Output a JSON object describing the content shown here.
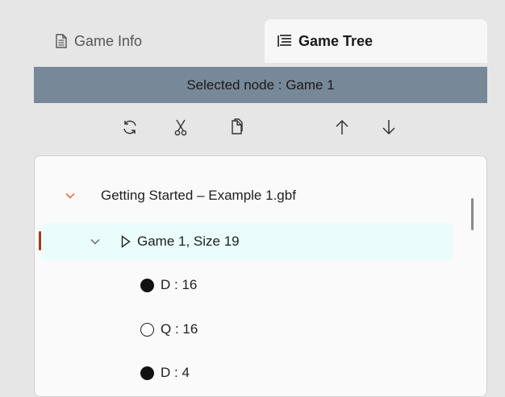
{
  "tabs": [
    {
      "label": "Game Info",
      "icon": "document-icon",
      "active": false
    },
    {
      "label": "Game Tree",
      "icon": "tree-list-icon",
      "active": true
    }
  ],
  "selected_node_text": "Selected node : Game 1",
  "toolbar": {
    "buttons": [
      "refresh-icon",
      "cut-icon",
      "paste-icon",
      "move-up-icon",
      "move-down-icon"
    ]
  },
  "tree": {
    "root": {
      "label": "Getting Started – Example 1.gbf",
      "expanded": true
    },
    "game": {
      "label": "Game 1, Size 19",
      "expanded": true,
      "selected": true
    },
    "moves": [
      {
        "color": "black",
        "label": "D : 16"
      },
      {
        "color": "white",
        "label": "Q : 16"
      },
      {
        "color": "black",
        "label": "D : 4"
      }
    ]
  },
  "colors": {
    "selected_bar": "#778899",
    "selected_row": "#eafcfc",
    "accent_chevron": "#e8704a",
    "selection_indicator": "#a33a12"
  }
}
